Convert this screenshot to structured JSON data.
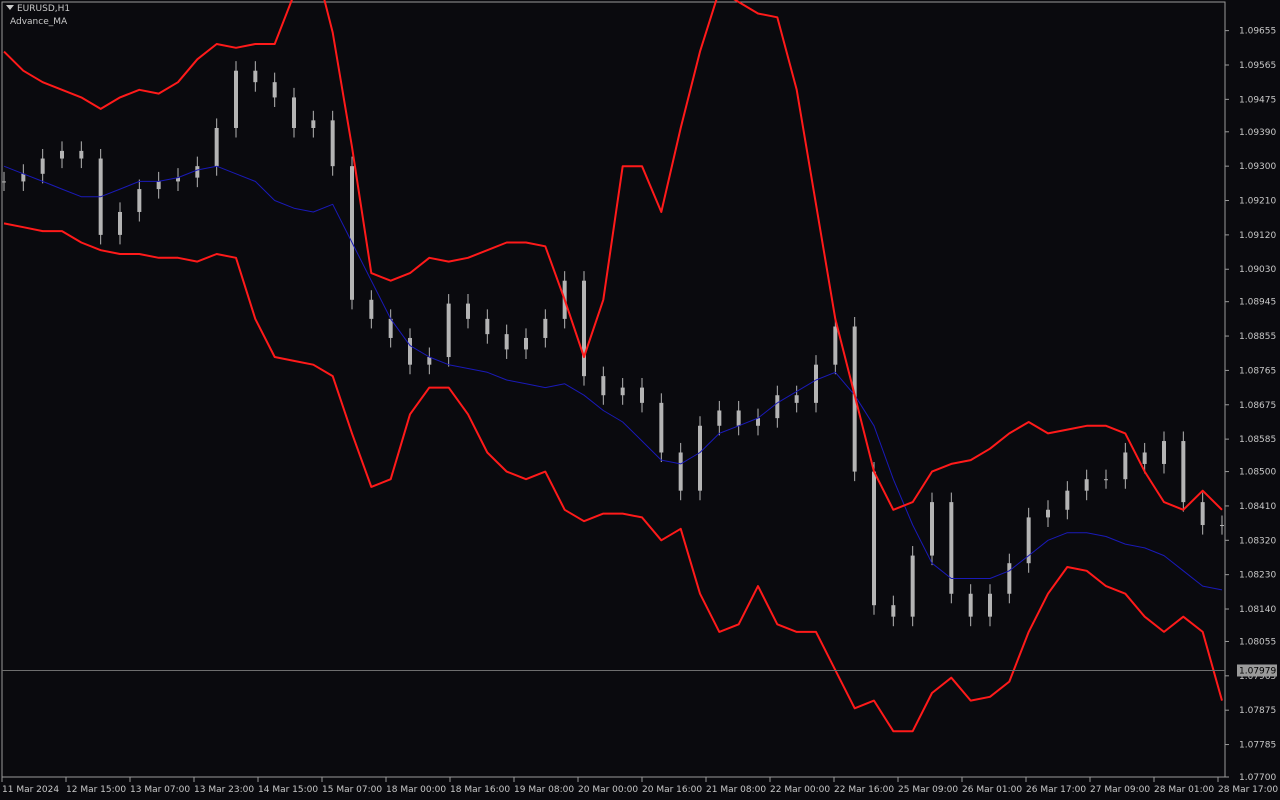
{
  "chart": {
    "symbol": "EURUSD,H1",
    "indicator": "Advance_MA",
    "current_price": "1.07979",
    "colors": {
      "background": "#0a0a0e",
      "frame": "#9a9a9a",
      "candle": "#b4b4b4",
      "ma": "#1a1ab8",
      "band": "#ff1a1a",
      "price_line": "#6e6e6e",
      "text": "#c8c8c8"
    },
    "price_labels": [
      "1.09655",
      "1.09565",
      "1.09475",
      "1.09390",
      "1.09300",
      "1.09210",
      "1.09120",
      "1.09030",
      "1.08945",
      "1.08855",
      "1.08765",
      "1.08675",
      "1.08585",
      "1.08500",
      "1.08410",
      "1.08320",
      "1.08230",
      "1.08140",
      "1.08055",
      "1.07965",
      "1.07875",
      "1.07785",
      "1.07700"
    ],
    "time_labels": [
      "11 Mar 2024",
      "12 Mar 15:00",
      "13 Mar 07:00",
      "13 Mar 23:00",
      "14 Mar 15:00",
      "15 Mar 07:00",
      "18 Mar 00:00",
      "18 Mar 16:00",
      "19 Mar 08:00",
      "20 Mar 00:00",
      "20 Mar 16:00",
      "21 Mar 08:00",
      "22 Mar 00:00",
      "22 Mar 16:00",
      "25 Mar 09:00",
      "26 Mar 01:00",
      "26 Mar 17:00",
      "27 Mar 09:00",
      "28 Mar 01:00",
      "28 Mar 17:00"
    ]
  },
  "chart_data": {
    "type": "line",
    "y_axis_range": [
      1.077,
      1.0973
    ],
    "series": [
      {
        "role": "close",
        "values": [
          1.0926,
          1.0928,
          1.0932,
          1.0934,
          1.0932,
          1.0912,
          1.0918,
          1.0924,
          1.0926,
          1.0927,
          1.093,
          1.094,
          1.0955,
          1.0952,
          1.0948,
          1.094,
          1.0942,
          1.093,
          1.0895,
          1.089,
          1.0885,
          1.0878,
          1.088,
          1.0894,
          1.089,
          1.0886,
          1.0882,
          1.0885,
          1.089,
          1.09,
          1.0875,
          1.087,
          1.0872,
          1.0868,
          1.0855,
          1.0845,
          1.0862,
          1.0866,
          1.0862,
          1.0864,
          1.087,
          1.0868,
          1.0878,
          1.0888,
          1.085,
          1.0815,
          1.0812,
          1.0828,
          1.0842,
          1.0818,
          1.0812,
          1.0818,
          1.0826,
          1.0838,
          1.084,
          1.0845,
          1.0848,
          1.0848,
          1.0855,
          1.0852,
          1.0858,
          1.0842,
          1.0836,
          1.0836
        ]
      },
      {
        "role": "moving-average",
        "values": [
          1.093,
          1.0928,
          1.0926,
          1.0924,
          1.0922,
          1.0922,
          1.0924,
          1.0926,
          1.0926,
          1.0927,
          1.0929,
          1.093,
          1.0928,
          1.0926,
          1.0921,
          1.0919,
          1.0918,
          1.092,
          1.091,
          1.09,
          1.089,
          1.0883,
          1.088,
          1.0878,
          1.0877,
          1.0876,
          1.0874,
          1.0873,
          1.0872,
          1.0873,
          1.087,
          1.0866,
          1.0863,
          1.0858,
          1.0853,
          1.0852,
          1.0855,
          1.086,
          1.0862,
          1.0864,
          1.0868,
          1.0871,
          1.0874,
          1.0876,
          1.087,
          1.0862,
          1.0848,
          1.0836,
          1.0826,
          1.0822,
          1.0822,
          1.0822,
          1.0824,
          1.0828,
          1.0832,
          1.0834,
          1.0834,
          1.0833,
          1.0831,
          1.083,
          1.0828,
          1.0824,
          1.082,
          1.0819
        ]
      },
      {
        "role": "upper-band",
        "values": [
          1.096,
          1.0955,
          1.0952,
          1.095,
          1.0948,
          1.0945,
          1.0948,
          1.095,
          1.0949,
          1.0952,
          1.0958,
          1.0962,
          1.0961,
          1.0962,
          1.0962,
          1.0975,
          1.0985,
          1.0965,
          1.0935,
          1.0902,
          1.09,
          1.0902,
          1.0906,
          1.0905,
          1.0906,
          1.0908,
          1.091,
          1.091,
          1.0909,
          1.0895,
          1.088,
          1.0895,
          1.093,
          1.093,
          1.0918,
          1.094,
          1.096,
          1.0976,
          1.0973,
          1.097,
          1.0969,
          1.095,
          1.092,
          1.089,
          1.087,
          1.085,
          1.084,
          1.0842,
          1.085,
          1.0852,
          1.0853,
          1.0856,
          1.086,
          1.0863,
          1.086,
          1.0861,
          1.0862,
          1.0862,
          1.086,
          1.085,
          1.0842,
          1.084,
          1.0845,
          1.084
        ]
      },
      {
        "role": "lower-band",
        "values": [
          1.0915,
          1.0914,
          1.0913,
          1.0913,
          1.091,
          1.0908,
          1.0907,
          1.0907,
          1.0906,
          1.0906,
          1.0905,
          1.0907,
          1.0906,
          1.089,
          1.088,
          1.0879,
          1.0878,
          1.0875,
          1.086,
          1.0846,
          1.0848,
          1.0865,
          1.0872,
          1.0872,
          1.0865,
          1.0855,
          1.085,
          1.0848,
          1.085,
          1.084,
          1.0837,
          1.0839,
          1.0839,
          1.0838,
          1.0832,
          1.0835,
          1.0818,
          1.0808,
          1.081,
          1.082,
          1.081,
          1.0808,
          1.0808,
          1.0798,
          1.0788,
          1.079,
          1.0782,
          1.0782,
          1.0792,
          1.0796,
          1.079,
          1.0791,
          1.0795,
          1.0808,
          1.0818,
          1.0825,
          1.0824,
          1.082,
          1.0818,
          1.0812,
          1.0808,
          1.0812,
          1.0808,
          1.079
        ]
      }
    ]
  }
}
